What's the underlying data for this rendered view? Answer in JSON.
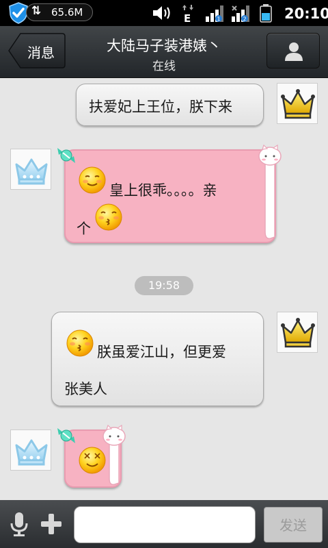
{
  "status_bar": {
    "sync_glyph": "⇅",
    "memory": "65.6M",
    "network_type": "E",
    "sim1_badge": "1",
    "sim2_badge": "2",
    "time": "20:10",
    "icons": [
      "shield-icon",
      "sync-icon",
      "volume-icon",
      "edge-network-icon",
      "signal-icon",
      "signal-icon",
      "battery-icon"
    ]
  },
  "header": {
    "back_label": "消息",
    "title": "大陆马子装港婊丶",
    "subtitle": "在线",
    "profile_icon": "person-icon"
  },
  "messages": [
    {
      "side": "right",
      "style": "gray",
      "text": "扶爱妃上王位，朕下来",
      "avatar": "gold-crown-icon"
    },
    {
      "side": "left",
      "style": "pink",
      "text_line1": "皇上很乖。。。。亲",
      "text_line2": "个",
      "avatar": "blue-crown-icon",
      "emojis": [
        "shy-smile-emoji",
        "kiss-emoji"
      ]
    },
    {
      "timestamp": "19:58"
    },
    {
      "side": "right",
      "style": "gray",
      "text_line1": "朕虽爱江山，但更爱",
      "text_line2": "张美人",
      "avatar": "gold-crown-icon",
      "emojis": [
        "kiss-emoji"
      ]
    },
    {
      "side": "left",
      "style": "pink",
      "avatar": "blue-crown-icon",
      "emojis": [
        "dizzy-smile-emoji"
      ]
    }
  ],
  "input_bar": {
    "mic_icon": "microphone-icon",
    "plus_icon": "plus-icon",
    "input_value": "",
    "send_label": "发送"
  },
  "colors": {
    "header_dark": "#2b2f33",
    "chat_bg": "#e6e6e6",
    "pink_bubble": "#f7b2c2",
    "gray_bubble": "#eeeeee",
    "send_disabled": "#c9c9c9"
  }
}
